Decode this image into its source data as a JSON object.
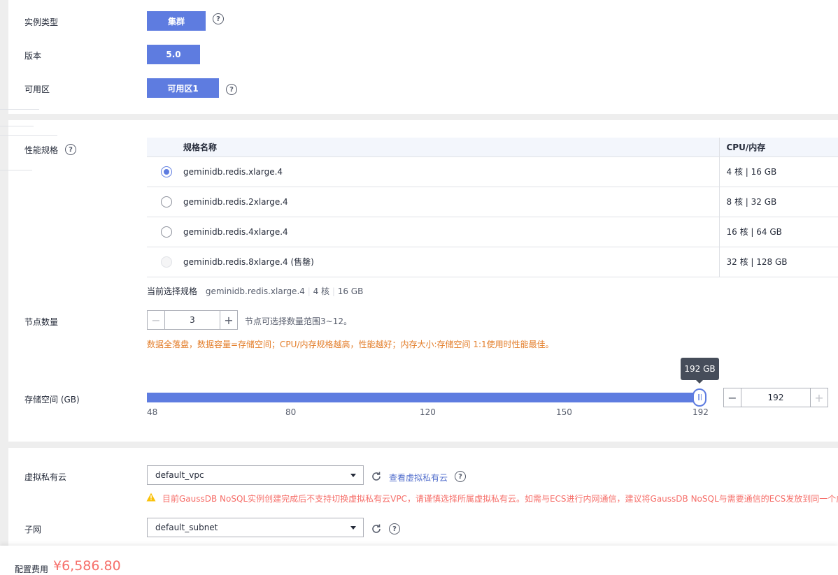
{
  "instance": {
    "type_label": "实例类型",
    "type_value": "集群",
    "version_label": "版本",
    "version_value": "5.0",
    "az_label": "可用区",
    "az_value": "可用区1"
  },
  "spec": {
    "label": "性能规格",
    "header_name": "规格名称",
    "header_cpu": "CPU/内存",
    "rows": [
      {
        "name": "geminidb.redis.xlarge.4",
        "cpu": "4 核 | 16 GB",
        "state": "checked"
      },
      {
        "name": "geminidb.redis.2xlarge.4",
        "cpu": "8 核 | 32 GB",
        "state": "unchecked"
      },
      {
        "name": "geminidb.redis.4xlarge.4",
        "cpu": "16 核 | 64 GB",
        "state": "unchecked"
      },
      {
        "name": "geminidb.redis.8xlarge.4 (售罄)",
        "cpu": "32 核 | 128 GB",
        "state": "disabled"
      }
    ],
    "current_label": "当前选择规格",
    "current_name": "geminidb.redis.xlarge.4",
    "current_cpu": "4 核",
    "current_mem": "16 GB"
  },
  "nodes": {
    "label": "节点数量",
    "minus": "−",
    "value": "3",
    "plus": "+",
    "hint": "节点可选择数量范围3~12。",
    "warning": "数据全落盘，数据容量=存储空间；CPU/内存规格越高，性能越好；内存大小:存储空间 1:1使用时性能最佳。"
  },
  "storage": {
    "label": "存储空间 (GB)",
    "tooltip": "192 GB",
    "min": 48,
    "max": 192,
    "value": 192,
    "ticks": [
      "48",
      "80",
      "120",
      "150",
      "192"
    ],
    "input_value": "192",
    "minus": "−",
    "plus": "+"
  },
  "vpc": {
    "label": "虚拟私有云",
    "value": "default_vpc",
    "link": "查看虚拟私有云",
    "warning": "目前GaussDB NoSQL实例创建完成后不支持切换虚拟私有云VPC，请谨慎选择所属虚拟私有云。如需与ECS进行内网通信，建议将GaussDB NoSQL与需要通信的ECS发放到同一个虚拟私有云"
  },
  "subnet": {
    "label": "子网",
    "value": "default_subnet"
  },
  "footer": {
    "cost_label": "配置费用",
    "cost_value": "¥6,586.80"
  },
  "colors": {
    "primary": "#5e7ce0",
    "warning_orange": "#e37d29",
    "error_red": "#f66f6a",
    "link_blue": "#526ecc"
  }
}
